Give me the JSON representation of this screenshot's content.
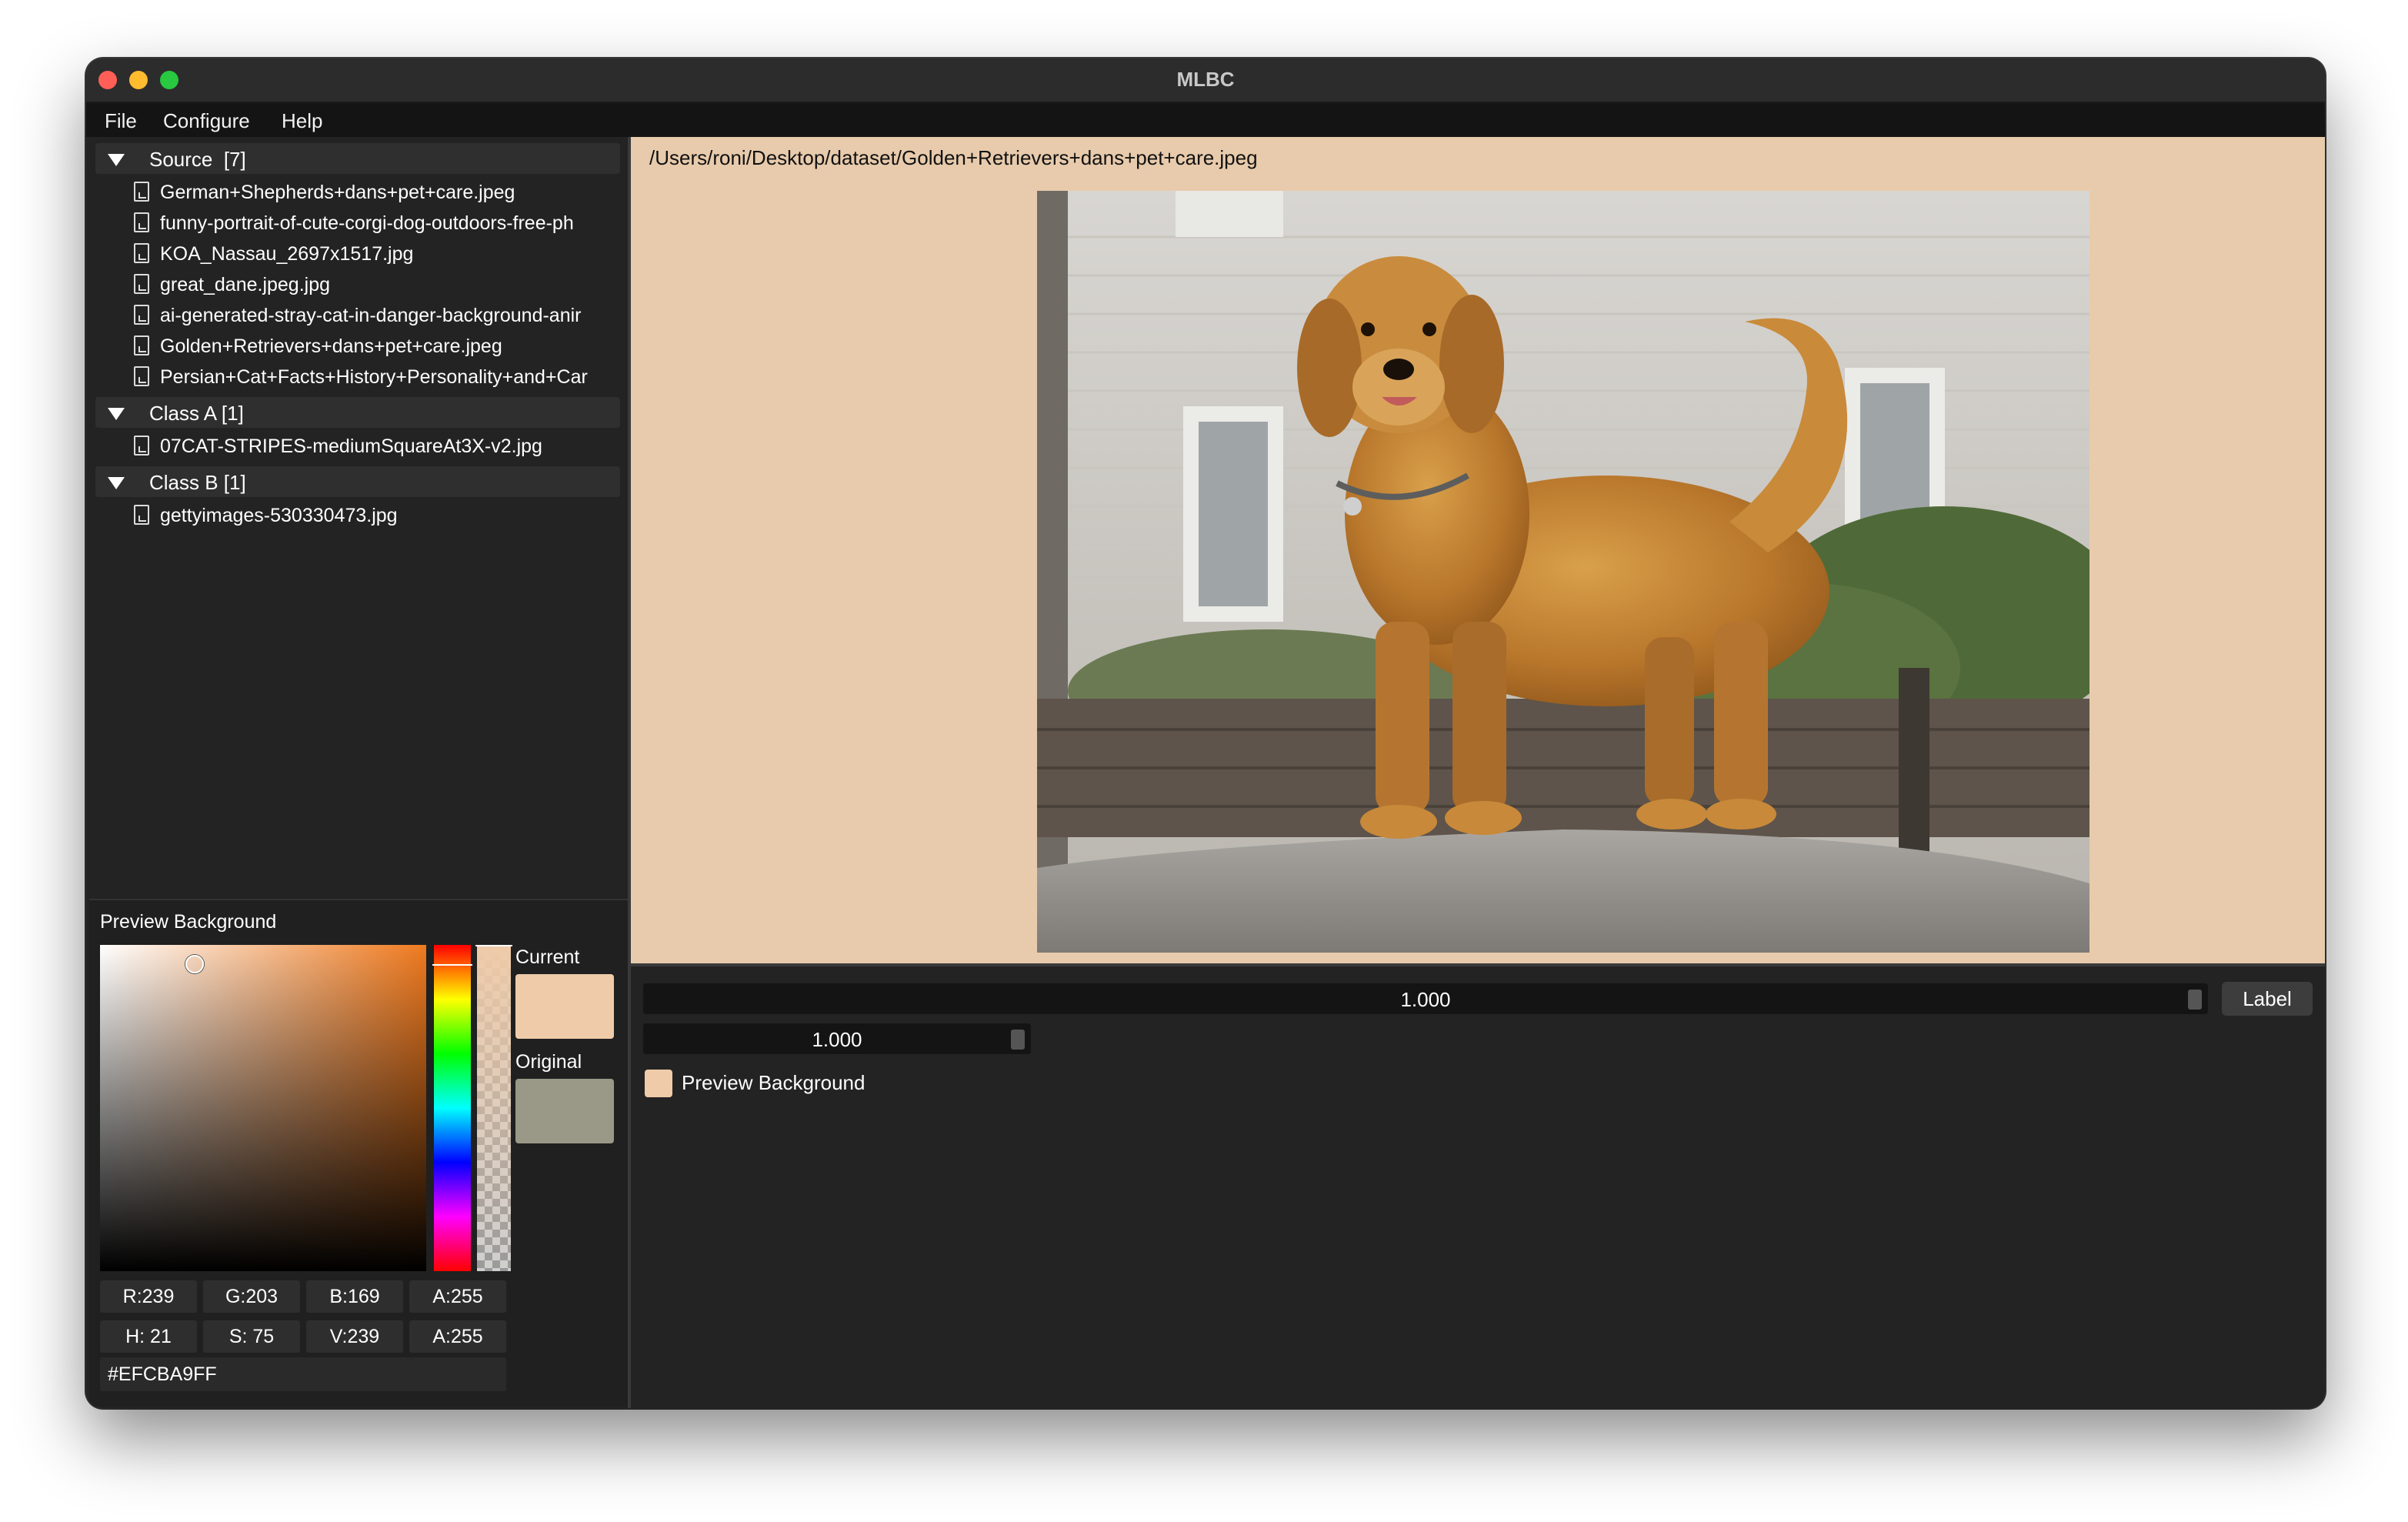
{
  "window": {
    "title": "MLBC"
  },
  "menu": [
    "File",
    "Configure",
    "Help"
  ],
  "tree": {
    "groups": [
      {
        "label": "Source  [7]",
        "files": [
          "German+Shepherds+dans+pet+care.jpeg",
          "funny-portrait-of-cute-corgi-dog-outdoors-free-ph",
          "KOA_Nassau_2697x1517.jpg",
          "great_dane.jpeg.jpg",
          "ai-generated-stray-cat-in-danger-background-anir",
          "Golden+Retrievers+dans+pet+care.jpeg",
          "Persian+Cat+Facts+History+Personality+and+Car"
        ]
      },
      {
        "label": "Class A [1]",
        "files": [
          "07CAT-STRIPES-mediumSquareAt3X-v2.jpg"
        ]
      },
      {
        "label": "Class B [1]",
        "files": [
          "gettyimages-530330473.jpg"
        ]
      }
    ]
  },
  "color_picker": {
    "title": "Preview Background",
    "current_label": "Current",
    "original_label": "Original",
    "current_color": "#efcba9",
    "original_color": "#9a9886",
    "rgba": [
      "R:239",
      "G:203",
      "B:169",
      "A:255"
    ],
    "hsva": [
      "H: 21",
      "S: 75",
      "V:239",
      "A:255"
    ],
    "hex": "#EFCBA9FF",
    "hue_level": 0.06,
    "saturation": 0.29,
    "value": 0.94
  },
  "preview": {
    "path": "/Users/roni/Desktop/dataset/Golden+Retrievers+dans+pet+care.jpeg",
    "background": "#e8cbac"
  },
  "controls": {
    "slider_main_value": "1.000",
    "slider_secondary_value": "1.000",
    "label_button": "Label",
    "preview_bg_checkbox_label": "Preview Background"
  }
}
